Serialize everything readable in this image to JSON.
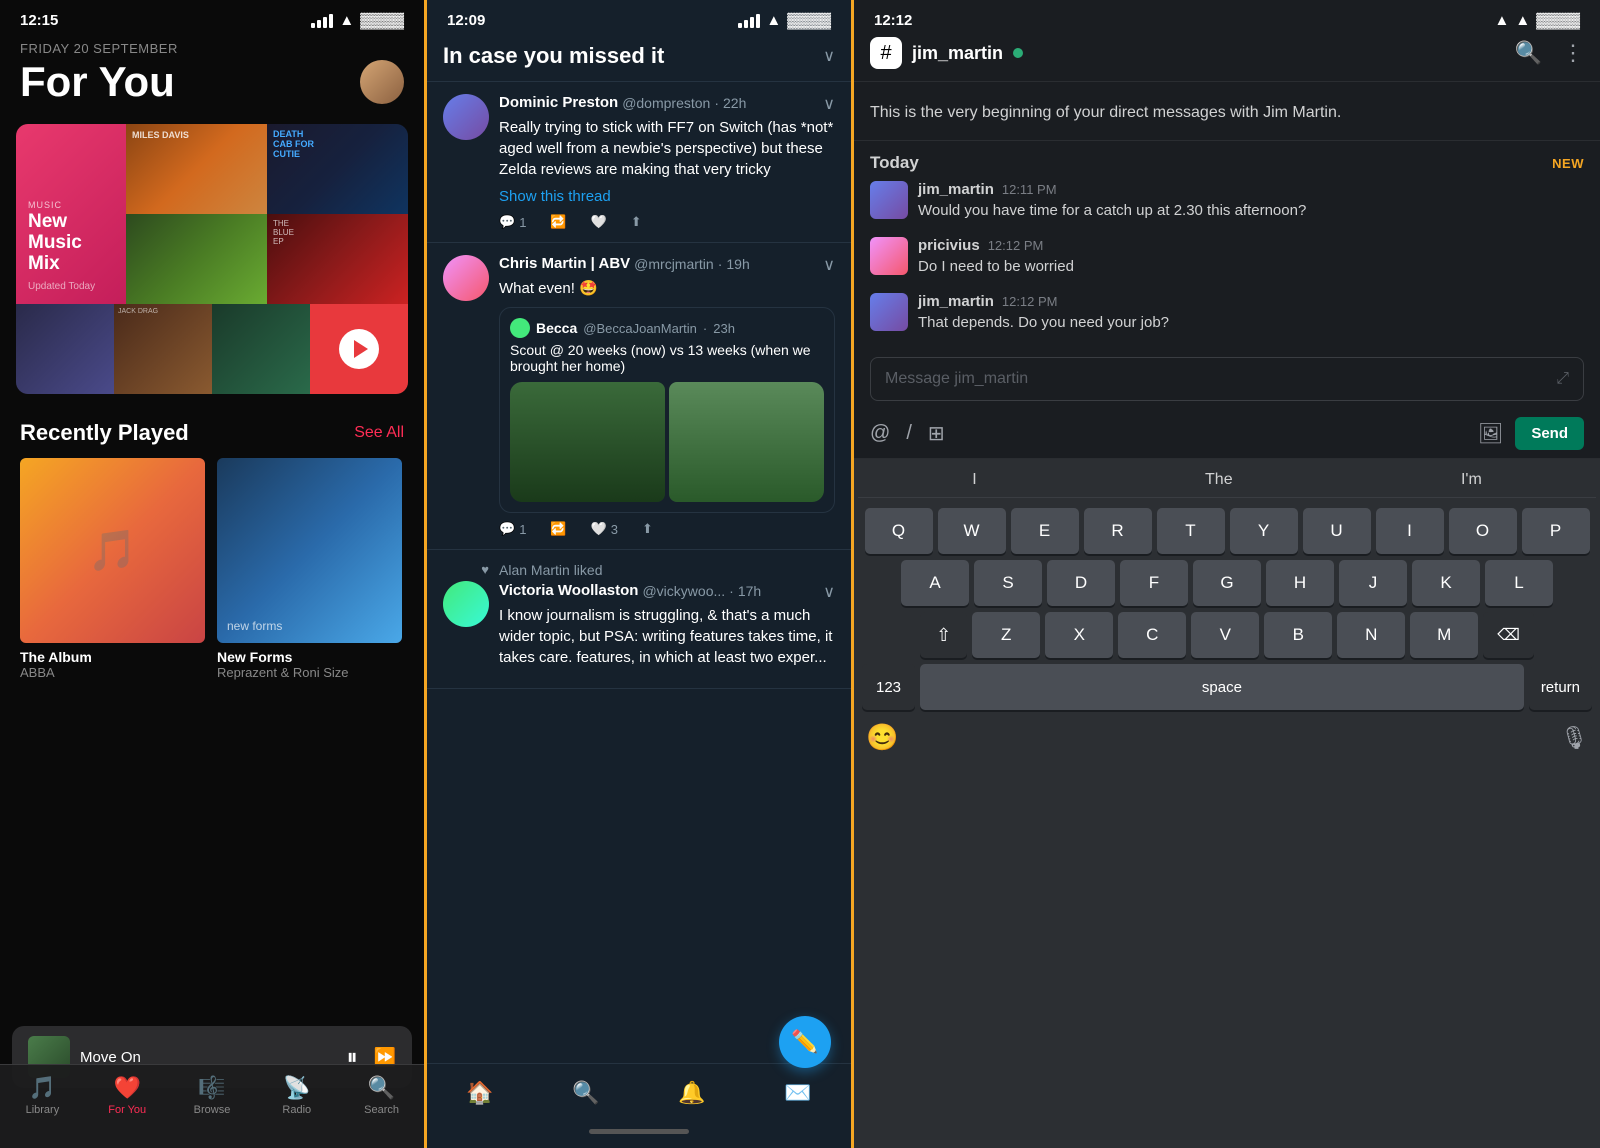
{
  "music": {
    "statusBar": {
      "time": "12:15"
    },
    "date": "FRIDAY 20 SEPTEMBER",
    "title": "For You",
    "newMusicMix": {
      "label": "MUSIC",
      "title": "New Music Mix",
      "sub": "",
      "updated": "Updated Today"
    },
    "recentlyPlayed": "Recently Played",
    "seeAll": "See All",
    "albums": [
      {
        "name": "The Album",
        "artist": "ABBA"
      },
      {
        "name": "New Forms",
        "artist": "Reprazent & Roni Size"
      }
    ],
    "nowPlaying": {
      "title": "Move On"
    },
    "tabs": [
      {
        "label": "Library",
        "icon": "🎵",
        "active": false
      },
      {
        "label": "For You",
        "icon": "❤️",
        "active": true
      },
      {
        "label": "Browse",
        "icon": "🎼",
        "active": false
      },
      {
        "label": "Radio",
        "icon": "📡",
        "active": false
      },
      {
        "label": "Search",
        "icon": "🔍",
        "active": false
      }
    ]
  },
  "twitter": {
    "statusBar": {
      "time": "12:09"
    },
    "sectionTitle": "In case you missed it",
    "tweets": [
      {
        "name": "Dominic Preston",
        "handle": "@dompreston",
        "time": "22h",
        "text": "Really trying to stick with FF7 on Switch (has *not* aged well from a newbie's perspective) but these Zelda reviews are making that very tricky",
        "showThread": "Show this thread",
        "actions": {
          "reply": "1",
          "retweet": "",
          "like": "",
          "share": ""
        }
      },
      {
        "name": "Chris Martin | ABV",
        "handle": "@mrcjmartin",
        "time": "19h",
        "text": "What even! 🤩",
        "quoted": {
          "avatar": "B",
          "name": "Becca",
          "handle": "@BeccaJoanMartin",
          "time": "23h",
          "text": "Scout @ 20 weeks (now) vs 13 weeks (when we brought her home)"
        },
        "actions": {
          "reply": "1",
          "retweet": "",
          "like": "3",
          "share": ""
        }
      },
      {
        "liked_by": "Alan Martin liked",
        "name": "Victoria Woollaston",
        "handle": "@vickywoo...",
        "time": "17h",
        "text": "I know journalism is struggling, & that's a much wider topic, but PSA: writing features takes time, it takes care. features, in which at least two exper..."
      }
    ],
    "tabs": [
      {
        "icon": "🏠",
        "active": true
      },
      {
        "icon": "🔍",
        "active": false
      },
      {
        "icon": "🔔",
        "active": false
      },
      {
        "icon": "✉️",
        "active": false
      }
    ]
  },
  "slack": {
    "statusBar": {
      "time": "12:12"
    },
    "username": "jim_martin",
    "introText": "This is the very beginning of your direct messages with Jim Martin.",
    "todayLabel": "Today",
    "newBadge": "NEW",
    "messages": [
      {
        "name": "jim_martin",
        "time": "12:11 PM",
        "text": "Would you have time for a catch up at 2.30 this afternoon?"
      },
      {
        "name": "pricivius",
        "time": "12:12 PM",
        "text": "Do I need to be worried"
      },
      {
        "name": "jim_martin",
        "time": "12:12 PM",
        "text": "That depends. Do you need your job?"
      }
    ],
    "inputPlaceholder": "Message jim_martin",
    "sendLabel": "Send",
    "suggestions": [
      "I",
      "The",
      "I'm"
    ],
    "keyboard": {
      "row1": [
        "Q",
        "W",
        "E",
        "R",
        "T",
        "Y",
        "U",
        "I",
        "O",
        "P"
      ],
      "row2": [
        "A",
        "S",
        "D",
        "F",
        "G",
        "H",
        "J",
        "K",
        "L"
      ],
      "row3": [
        "Z",
        "X",
        "C",
        "V",
        "B",
        "N",
        "M"
      ],
      "num": "123",
      "space": "space",
      "return": "return"
    }
  }
}
